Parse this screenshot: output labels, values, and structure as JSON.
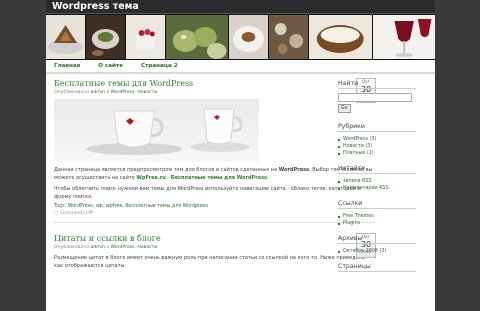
{
  "site": {
    "title": "Wordpress тема"
  },
  "nav": [
    {
      "label": "Главная"
    },
    {
      "label": "О сайте"
    },
    {
      "label": "Страница 2"
    }
  ],
  "posts": [
    {
      "title": "Бесплатные темы для WordPress",
      "meta_prefix": "Опубликовано",
      "author": "admin",
      "meta_in": "в",
      "category1": "WordPress",
      "category2": "Новости",
      "date": {
        "month": "Окт",
        "day": "30",
        "year": "2008"
      },
      "para1_pre": "Данная страница является предпросмотром тем для блогов и сайтов сделанных на ",
      "para1_bold": "WordPress",
      "para1_mid": ". Выбор тем (скинов) вы можете осуществить на сайте ",
      "para1_link1": "WpFree.ru",
      "para1_dash": " - ",
      "para1_link2": "Бесплатные темы для WordPress",
      "para1_end": ".",
      "para2": "Чтобы облегчить поиск нужной вам темы для WordPress используйте навигацию сайта - облако тегов, категории и форму поиска.",
      "tags_label": "Tags:",
      "tags": [
        "WordPress",
        "wp",
        "wpfree",
        "бесплатные темы для Wordpress"
      ],
      "comments": "Comments Off"
    },
    {
      "title": "Цитаты и ссылки в блоге",
      "meta_prefix": "Опубликовано",
      "author": "admin",
      "meta_in": "в",
      "category1": "WordPress",
      "category2": "Новости",
      "date": {
        "month": "Окт",
        "day": "30",
        "year": "2008"
      },
      "para1": "Размещение цитат в блоге имеет очень важную роль при написании статьи со ссылкой на кого-то. Ниже приведено как отображаются цитаты."
    }
  ],
  "sidebar": {
    "search_title": "Найти",
    "search_button": "Go",
    "rubrics_title": "Рубрики",
    "rubrics": [
      {
        "name": "WordPress",
        "count": "(3)"
      },
      {
        "name": "Новости",
        "count": "(3)"
      },
      {
        "name": "Платные",
        "count": "(1)"
      }
    ],
    "read_title": "Читайте",
    "read": [
      {
        "name": "записи RSS"
      },
      {
        "name": "Комментарии RSS"
      }
    ],
    "links_title": "Ссылки",
    "links": [
      {
        "name": "Free Themes"
      },
      {
        "name": "Plugins"
      }
    ],
    "archive_title": "Архивы",
    "archive": [
      {
        "name": "Октябрь 2008",
        "count": "(3)"
      }
    ],
    "pages_title": "Страницы"
  },
  "colors": {
    "accent": "#2e7d32",
    "background": "#3a3a3a",
    "header": "#2b2b2b"
  }
}
